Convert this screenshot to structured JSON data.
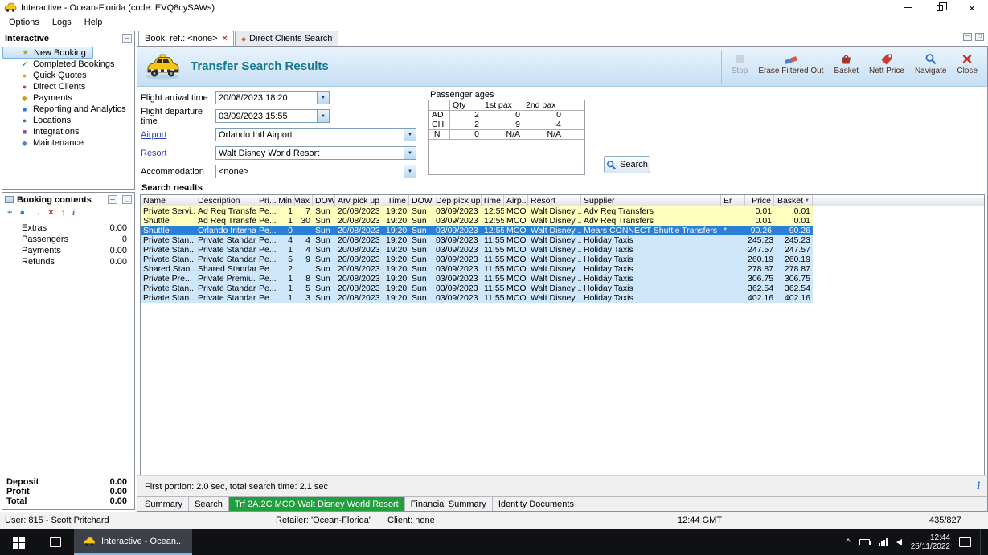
{
  "window": {
    "title": "Interactive - Ocean-Florida (code: EVQ8cySAWs)",
    "menus": [
      "Options",
      "Logs",
      "Help"
    ]
  },
  "colors": {
    "accent_teal": "#13798e",
    "row_yellow": "#ffffbe",
    "row_selected": "#2a7fd8",
    "row_blue": "#cfe7fa",
    "tab_green": "#1fa03c"
  },
  "sidebar": {
    "title": "Interactive",
    "items": [
      {
        "label": "New Booking",
        "icon": "new-booking-icon",
        "selected": true
      },
      {
        "label": "Completed Bookings",
        "icon": "completed-bookings-icon"
      },
      {
        "label": "Quick Quotes",
        "icon": "quick-quotes-icon"
      },
      {
        "label": "Direct Clients",
        "icon": "direct-clients-icon"
      },
      {
        "label": "Payments",
        "icon": "payments-icon"
      },
      {
        "label": "Reporting and Analytics",
        "icon": "reporting-icon"
      },
      {
        "label": "Locations",
        "icon": "locations-icon"
      },
      {
        "label": "Integrations",
        "icon": "integrations-icon"
      },
      {
        "label": "Maintenance",
        "icon": "maintenance-icon"
      }
    ]
  },
  "booking_contents": {
    "title": "Booking contents",
    "toolbar_icons": [
      "add-icon",
      "globe-icon",
      "transfer-icon",
      "delete-icon",
      "upload-icon",
      "info-icon"
    ],
    "rows": [
      {
        "label": "Extras",
        "value": "0.00"
      },
      {
        "label": "Passengers",
        "value": "0"
      },
      {
        "label": "Payments",
        "value": "0.00"
      },
      {
        "label": "Refunds",
        "value": "0.00"
      }
    ],
    "totals": [
      {
        "label": "Deposit",
        "value": "0.00"
      },
      {
        "label": "Profit",
        "value": "0.00"
      },
      {
        "label": "Total",
        "value": "0.00"
      }
    ]
  },
  "tabs": {
    "items": [
      {
        "label": "Book. ref.: <none>",
        "active": true,
        "closable": true
      },
      {
        "label": "Direct Clients Search",
        "icon": "direct-clients-tab-icon"
      }
    ]
  },
  "header": {
    "title": "Transfer Search Results",
    "toolbar": [
      {
        "label": "Stop",
        "icon": "stop-icon",
        "disabled": true
      },
      {
        "label": "Erase Filtered Out",
        "icon": "erase-icon"
      },
      {
        "label": "Basket",
        "icon": "basket-icon"
      },
      {
        "label": "Nett Price",
        "icon": "nett-price-icon"
      },
      {
        "label": "Navigate",
        "icon": "navigate-icon"
      },
      {
        "label": "Close",
        "icon": "close-icon"
      }
    ]
  },
  "form": {
    "fields": [
      {
        "label": "Flight arrival time",
        "value": "20/08/2023 18:20",
        "wide": false,
        "link": false
      },
      {
        "label": "Flight departure time",
        "value": "03/09/2023 15:55",
        "wide": false,
        "link": false
      },
      {
        "label": "Airport",
        "value": "Orlando Intl Airport",
        "wide": true,
        "link": true
      },
      {
        "label": "Resort",
        "value": "Walt Disney World Resort",
        "wide": true,
        "link": true
      },
      {
        "label": "Accommodation",
        "value": "<none>",
        "wide": true,
        "link": false
      }
    ],
    "passenger_ages": {
      "title": "Passenger ages",
      "columns": [
        "Qty",
        "1st pax",
        "2nd pax"
      ],
      "rows": [
        {
          "label": "AD",
          "cells": [
            "2",
            "0",
            "0"
          ]
        },
        {
          "label": "CH",
          "cells": [
            "2",
            "9",
            "4"
          ]
        },
        {
          "label": "IN",
          "cells": [
            "0",
            "N/A",
            "N/A"
          ]
        }
      ]
    },
    "search_button": "Search"
  },
  "results": {
    "section_title": "Search results",
    "status": "First portion: 2.0 sec, total search time: 2.1 sec",
    "columns": [
      "Name",
      "Description",
      "Pri...",
      "Min",
      "Max",
      "DOW",
      "Arv pick up",
      "Time",
      "DOW",
      "Dep pick up",
      "Time",
      "Airp...",
      "Resort",
      "Supplier",
      "Er",
      "Price",
      "Basket"
    ],
    "rows": [
      {
        "style": "yellow",
        "cells": [
          "Private Servi...",
          "Ad Req Transfer...",
          "Pe...",
          "1",
          "7",
          "Sun",
          "20/08/2023",
          "19:20",
          "Sun",
          "03/09/2023",
          "12:55",
          "MCO",
          "Walt Disney ...",
          "Adv Req Transfers",
          "",
          "0.01",
          "0.01"
        ]
      },
      {
        "style": "yellow",
        "cells": [
          "Shuttle",
          "Ad Req Transfer...",
          "Pe...",
          "1",
          "30",
          "Sun",
          "20/08/2023",
          "19:20",
          "Sun",
          "03/09/2023",
          "12:55",
          "MCO",
          "Walt Disney ...",
          "Adv Req Transfers",
          "",
          "0.01",
          "0.01"
        ]
      },
      {
        "style": "selected",
        "cells": [
          "Shuttle",
          "Orlando Interna...",
          "Pe...",
          "0",
          "",
          "Sun",
          "20/08/2023",
          "19:20",
          "Sun",
          "03/09/2023",
          "12:55",
          "MCO",
          "Walt Disney ...",
          "Mears CONNECT Shuttle Transfers",
          "*",
          "90.26",
          "90.26"
        ]
      },
      {
        "style": "blue",
        "cells": [
          "Private Stan...",
          "Private Standar...",
          "Pe...",
          "4",
          "4",
          "Sun",
          "20/08/2023",
          "19:20",
          "Sun",
          "03/09/2023",
          "11:55",
          "MCO",
          "Walt Disney ...",
          "Holiday Taxis",
          "",
          "245.23",
          "245.23"
        ]
      },
      {
        "style": "blue",
        "cells": [
          "Private Stan...",
          "Private Standar...",
          "Pe...",
          "1",
          "4",
          "Sun",
          "20/08/2023",
          "19:20",
          "Sun",
          "03/09/2023",
          "11:55",
          "MCO",
          "Walt Disney ...",
          "Holiday Taxis",
          "",
          "247.57",
          "247.57"
        ]
      },
      {
        "style": "blue",
        "cells": [
          "Private Stan...",
          "Private Standar...",
          "Pe...",
          "5",
          "9",
          "Sun",
          "20/08/2023",
          "19:20",
          "Sun",
          "03/09/2023",
          "11:55",
          "MCO",
          "Walt Disney ...",
          "Holiday Taxis",
          "",
          "260.19",
          "260.19"
        ]
      },
      {
        "style": "blue",
        "cells": [
          "Shared Stan...",
          "Shared Standar...",
          "Pe...",
          "2",
          "",
          "Sun",
          "20/08/2023",
          "19:20",
          "Sun",
          "03/09/2023",
          "11:55",
          "MCO",
          "Walt Disney ...",
          "Holiday Taxis",
          "",
          "278.87",
          "278.87"
        ]
      },
      {
        "style": "blue",
        "cells": [
          "Private Pre...",
          "Private Premiu...",
          "Pe...",
          "1",
          "8",
          "Sun",
          "20/08/2023",
          "19:20",
          "Sun",
          "03/09/2023",
          "11:55",
          "MCO",
          "Walt Disney ...",
          "Holiday Taxis",
          "",
          "306.75",
          "306.75"
        ]
      },
      {
        "style": "blue",
        "cells": [
          "Private Stan...",
          "Private Standar...",
          "Pe...",
          "1",
          "5",
          "Sun",
          "20/08/2023",
          "19:20",
          "Sun",
          "03/09/2023",
          "11:55",
          "MCO",
          "Walt Disney ...",
          "Holiday Taxis",
          "",
          "362.54",
          "362.54"
        ]
      },
      {
        "style": "blue",
        "cells": [
          "Private Stan...",
          "Private Standar...",
          "Pe...",
          "1",
          "3",
          "Sun",
          "20/08/2023",
          "19:20",
          "Sun",
          "03/09/2023",
          "11:55",
          "MCO",
          "Walt Disney ...",
          "Holiday Taxis",
          "",
          "402.16",
          "402.16"
        ]
      }
    ]
  },
  "bottom_tabs": [
    {
      "label": "Summary"
    },
    {
      "label": "Search"
    },
    {
      "label": "Trf 2A,2C MCO Walt Disney World Resort",
      "active": true
    },
    {
      "label": "Financial Summary"
    },
    {
      "label": "Identity Documents"
    }
  ],
  "status_bar": {
    "user": "User: 815 - Scott Pritchard",
    "retailer": "Retailer: 'Ocean-Florida'",
    "client": "Client: none",
    "time": "12:44 GMT",
    "counter": "435/827"
  },
  "taskbar": {
    "app_label": "Interactive - Ocean...",
    "clock_time": "12:44",
    "clock_date": "25/11/2022"
  }
}
